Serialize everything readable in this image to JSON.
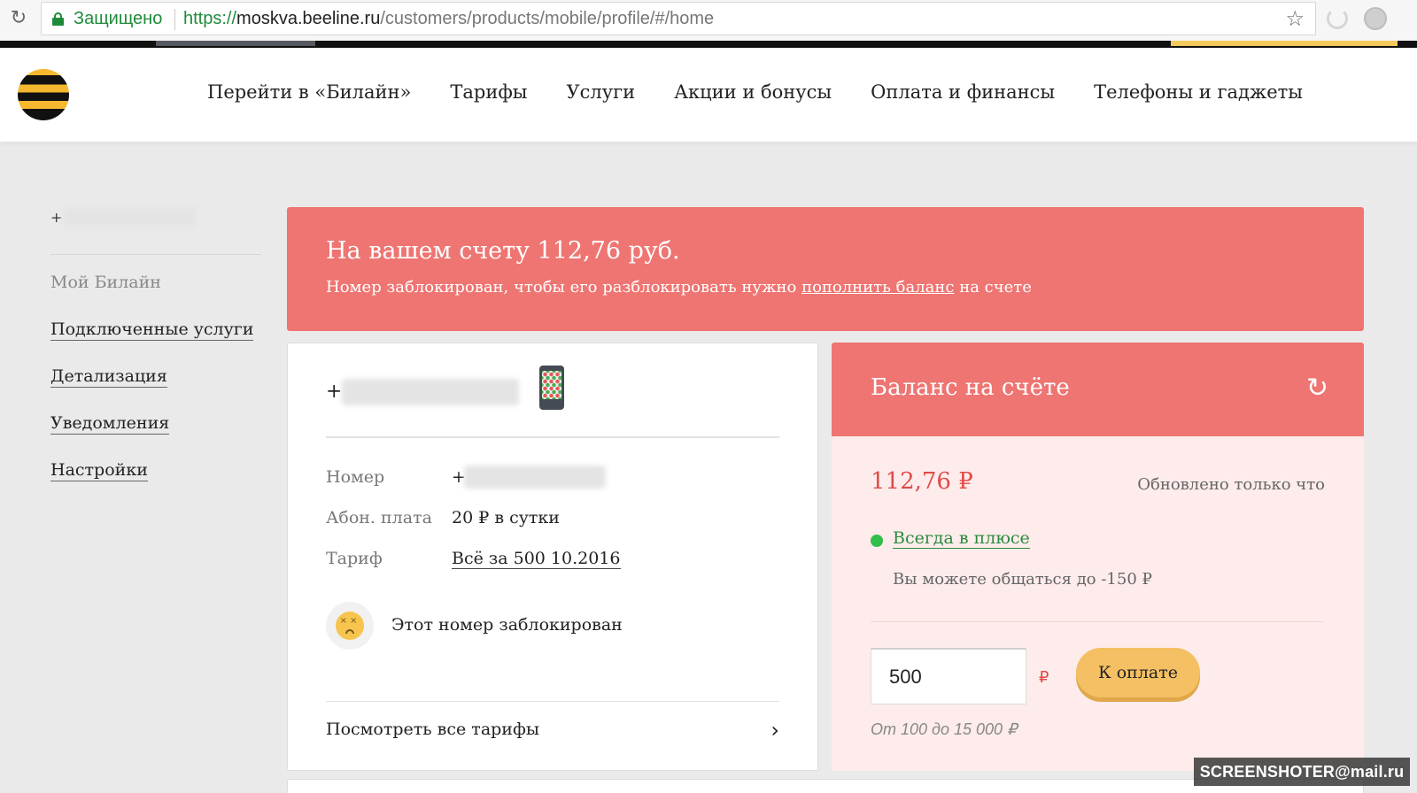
{
  "browser": {
    "secure_label": "Защищено",
    "url_scheme": "https://",
    "url_host": "moskva.beeline.ru",
    "url_path": "/customers/products/mobile/profile/#/home"
  },
  "header": {
    "nav": [
      "Перейти в «Билайн»",
      "Тарифы",
      "Услуги",
      "Акции и бонусы",
      "Оплата и финансы",
      "Телефоны и гаджеты"
    ]
  },
  "sidebar": {
    "phone_prefix": "+",
    "items": [
      {
        "label": "Мой Билайн",
        "active": true
      },
      {
        "label": "Подключенные услуги"
      },
      {
        "label": "Детализация"
      },
      {
        "label": "Уведомления"
      },
      {
        "label": "Настройки"
      }
    ]
  },
  "alert": {
    "title": "На вашем счету 112,76 руб.",
    "text_before": "Номер заблокирован, чтобы его разблокировать нужно",
    "link": "пополнить баланс",
    "text_after": "на счете"
  },
  "number_card": {
    "phone_prefix": "+",
    "rows": {
      "number_label": "Номер",
      "number_prefix": "+",
      "fee_label": "Абон. плата",
      "fee_value": "20 ₽ в сутки",
      "tariff_label": "Тариф",
      "tariff_value": "Всё за 500 10.2016"
    },
    "blocked_text": "Этот номер заблокирован",
    "all_tariffs": "Посмотреть все тарифы"
  },
  "balance_card": {
    "title": "Баланс на счёте",
    "amount": "112,76 ₽",
    "updated": "Обновлено только что",
    "always_plus": "Всегда в плюсе",
    "limit": "Вы можете общаться до -150 ₽",
    "input_value": "500",
    "currency": "₽",
    "pay_button": "К оплате",
    "range_hint": "От 100 до 15 000 ₽"
  },
  "watermark": "SCREENSHOTER@mail.ru",
  "colors": {
    "accent_red": "#ee7572",
    "brand_yellow": "#f5b82e",
    "secure_green": "#1f8b3a",
    "status_green": "#2fbf4a"
  }
}
